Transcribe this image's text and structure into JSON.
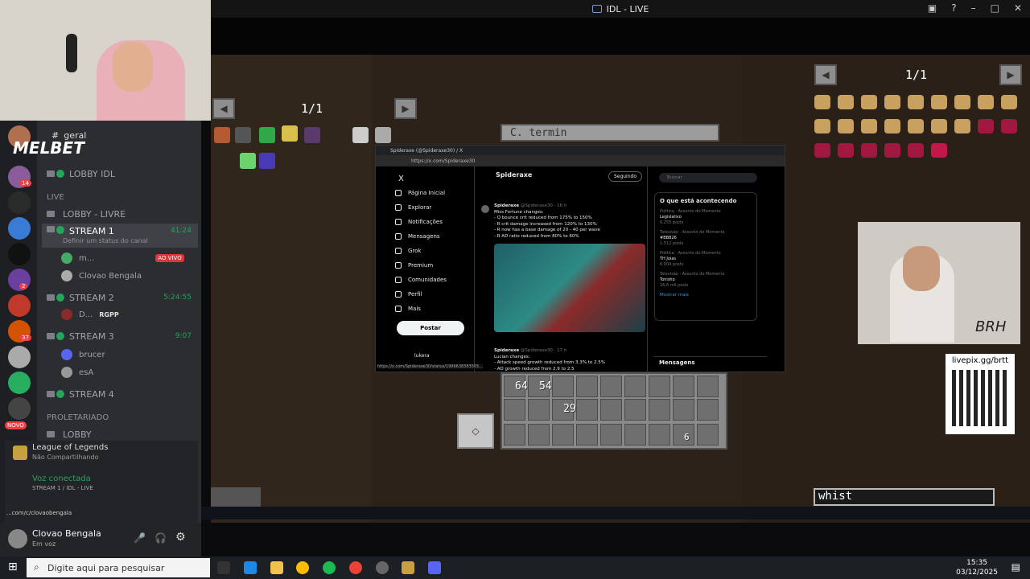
{
  "window": {
    "title": "IDL - LIVE"
  },
  "game": {
    "left_page": "1/1",
    "right_page": "1/1",
    "sign_text": "C. termin",
    "stack_a": "64",
    "stack_b": "54",
    "stack_c": "29",
    "stack_d": "6",
    "chat_input": "whist"
  },
  "overlay": {
    "melbet_logo": "MELBET",
    "livepix": "livepix.gg/brtt"
  },
  "discord": {
    "channel_text": "geral",
    "channels": [
      {
        "label": "LOBBY IDL"
      },
      {
        "label": "LOBBY - LIVRE"
      },
      {
        "label": "STREAM 1",
        "time": "41:24",
        "status_hint": "Definir um status do canal"
      },
      {
        "label": "STREAM 2",
        "time": "5:24:55"
      },
      {
        "label": "STREAM 3",
        "time": "9:07"
      },
      {
        "label": "STREAM 4"
      },
      {
        "label": "LOBBY"
      }
    ],
    "categories": {
      "live": "LIVE",
      "proletariado": "PROLETARIADO"
    },
    "members": {
      "s1_a": "m...",
      "s1_a_badge": "AO VIVO",
      "s1_b": "Clovao Bengala",
      "s2_a": "D...",
      "s2_a_game": "RGPP",
      "s3_a": "brucer",
      "s3_b": "esA"
    },
    "server_badges": [
      "14",
      "2",
      "37"
    ],
    "new_badge": "NOVO",
    "activity": {
      "game": "League of Legends",
      "share_status": "Não Compartilhando"
    },
    "voice": {
      "status": "Voz conectada",
      "channel": "STREAM 1 / IDL - LIVE"
    },
    "link_hint": "...com/c/clovaobengala",
    "user": {
      "name": "Clovao Bengala",
      "status": "Em voz"
    }
  },
  "browser": {
    "tab_title": "Spideraxe (@Spideraxe30) / X",
    "url": "https://x.com/Spideraxe30",
    "status_url": "https://x.com/Spideraxe30/status/1996638383565...",
    "nav": [
      "Página Inicial",
      "Explorar",
      "Notificações",
      "Mensagens",
      "Grok",
      "Premium",
      "Comunidades",
      "Perfil",
      "Mais"
    ],
    "post_button": "Postar",
    "profile_header": "Spideraxe",
    "follow_button": "Seguindo",
    "account_name": "lukera",
    "tweet1": {
      "author": "Spideraxe",
      "handle": "@Spideraxe30 · 16 h",
      "lines": [
        "Miss Fortune changes:",
        "- Q bounce crit reduced from 175% to 150%",
        "- R crit damage increased from 120% to 130%",
        "- R now has a base damage of 20 - 40 per wave",
        "- R AD ratio reduced from 80% to 60%"
      ]
    },
    "tweet2": {
      "author": "Spideraxe",
      "handle": "@Spideraxe30 · 17 h",
      "lines": [
        "Lucian changes:",
        "- Attack speed growth reduced from 3.3% to 2.5%",
        "- AD growth reduced from 2.9 to 2.5"
      ]
    },
    "search_placeholder": "Buscar",
    "trends_title": "O que está acontecendo",
    "trends": [
      {
        "meta": "Política · Assunto do Momento",
        "name": "Legislativo",
        "count": "6.255 posts"
      },
      {
        "meta": "Televisão · Assunto do Momento",
        "name": "#BBB26",
        "count": "1.512 posts"
      },
      {
        "meta": "Política · Assunto do Momento",
        "name": "TH Joias",
        "count": "6.004 posts"
      },
      {
        "meta": "Televisão · Assunto do Momento",
        "name": "Tonisho",
        "count": "16,6 mil posts"
      }
    ],
    "show_more": "Mostrar mais",
    "messages_title": "Mensagens"
  },
  "taskbar": {
    "search_placeholder": "Digite aqui para pesquisar",
    "time": "15:35",
    "date": "03/12/2025"
  }
}
